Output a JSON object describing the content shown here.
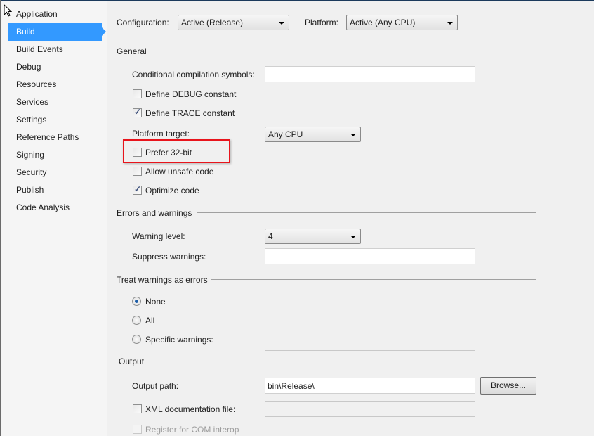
{
  "sidebar": {
    "items": [
      {
        "label": "Application"
      },
      {
        "label": "Build",
        "selected": true
      },
      {
        "label": "Build Events"
      },
      {
        "label": "Debug"
      },
      {
        "label": "Resources"
      },
      {
        "label": "Services"
      },
      {
        "label": "Settings"
      },
      {
        "label": "Reference Paths"
      },
      {
        "label": "Signing"
      },
      {
        "label": "Security"
      },
      {
        "label": "Publish"
      },
      {
        "label": "Code Analysis"
      }
    ]
  },
  "header": {
    "configuration_label": "Configuration:",
    "configuration_value": "Active (Release)",
    "platform_label": "Platform:",
    "platform_value": "Active (Any CPU)"
  },
  "general": {
    "title": "General",
    "cond_symbols_label": "Conditional compilation symbols:",
    "cond_symbols_value": "",
    "define_debug": {
      "label": "Define DEBUG constant",
      "checked": false
    },
    "define_trace": {
      "label": "Define TRACE constant",
      "checked": true
    },
    "platform_target_label": "Platform target:",
    "platform_target_value": "Any CPU",
    "prefer32": {
      "label": "Prefer 32-bit",
      "checked": false
    },
    "unsafe": {
      "label": "Allow unsafe code",
      "checked": false
    },
    "optimize": {
      "label": "Optimize code",
      "checked": true
    }
  },
  "errors": {
    "title": "Errors and warnings",
    "warning_level_label": "Warning level:",
    "warning_level_value": "4",
    "suppress_label": "Suppress warnings:",
    "suppress_value": ""
  },
  "treat": {
    "title": "Treat warnings as errors",
    "none": "None",
    "all": "All",
    "specific": "Specific warnings:",
    "selected": "None"
  },
  "output": {
    "title": "Output",
    "path_label": "Output path:",
    "path_value": "bin\\Release\\",
    "browse": "Browse...",
    "xml_label": "XML documentation file:",
    "com_label": "Register for COM interop"
  },
  "colors": {
    "selection": "#3399ff",
    "highlight": "#e8141c"
  }
}
